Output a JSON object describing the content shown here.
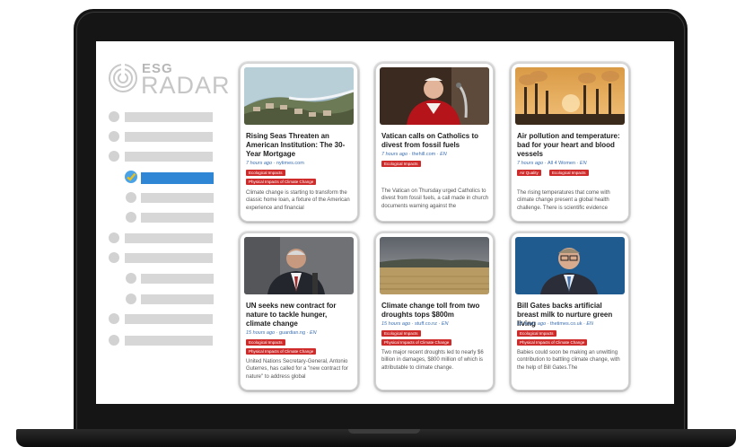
{
  "logo": {
    "top": "ESG",
    "bottom": "RADAR"
  },
  "articles": [
    {
      "title": "Rising Seas Threaten an American Institution: The 30-Year Mortgage",
      "time": "7 hours ago",
      "source": "nytimes.com",
      "lang": "",
      "tags": [
        "Ecological Impacts",
        "Physical Impacts of Climate Change"
      ],
      "snippet": "Climate change is starting to transform the classic home loan, a fixture of the American experience and financial",
      "image": "coast-houses-icon"
    },
    {
      "title": "Vatican calls on Catholics to divest from fossil fuels",
      "time": "7 hours ago",
      "source": "thehill.com",
      "lang": "EN",
      "tags": [
        "Ecological Impacts"
      ],
      "snippet": "The Vatican on Thursday urged Catholics to divest from fossil fuels, a call made in church documents warning against the",
      "image": "pope-icon"
    },
    {
      "title": "Air pollution and temperature: bad for your heart and blood vessels",
      "time": "7 hours ago",
      "source": "All 4 Women",
      "lang": "EN",
      "tags": [
        "Air Quality",
        "Ecological Impacts"
      ],
      "snippet": "The rising temperatures that come with climate change present a global health challenge. There is scientific evidence",
      "image": "factory-smoke-icon"
    },
    {
      "title": "UN seeks new contract for nature to tackle hunger, climate change",
      "time": "15 hours ago",
      "source": "guardian.ng",
      "lang": "EN",
      "tags": [
        "Ecological Impacts",
        "Physical Impacts of Climate Change"
      ],
      "snippet": "United Nations Secretary-General, Antonio Guterres, has called for a \"new contract for nature\" to address global",
      "image": "speaker-icon"
    },
    {
      "title": "Climate change toll from two droughts tops $800m",
      "time": "15 hours ago",
      "source": "stuff.co.nz",
      "lang": "EN",
      "tags": [
        "Ecological Impacts",
        "Physical Impacts of Climate Change"
      ],
      "snippet": "Two major recent droughts led to nearly $6 billion in damages, $800 million of which is attributable to climate change.",
      "image": "dry-field-icon"
    },
    {
      "title": "Bill Gates backs artificial breast milk to nurture green living",
      "time": "18 hours ago",
      "source": "thetimes.co.uk",
      "lang": "EN",
      "tags": [
        "Ecological Impacts",
        "Physical Impacts of Climate Change"
      ],
      "snippet": "Babies could soon be making an unwitting contribution to battling climate change, with the help of Bill Gates.The",
      "image": "portrait-icon"
    }
  ],
  "colors": {
    "tag": "#cf2b2b",
    "active": "#2e86d4",
    "meta": "#3c6fb0"
  }
}
